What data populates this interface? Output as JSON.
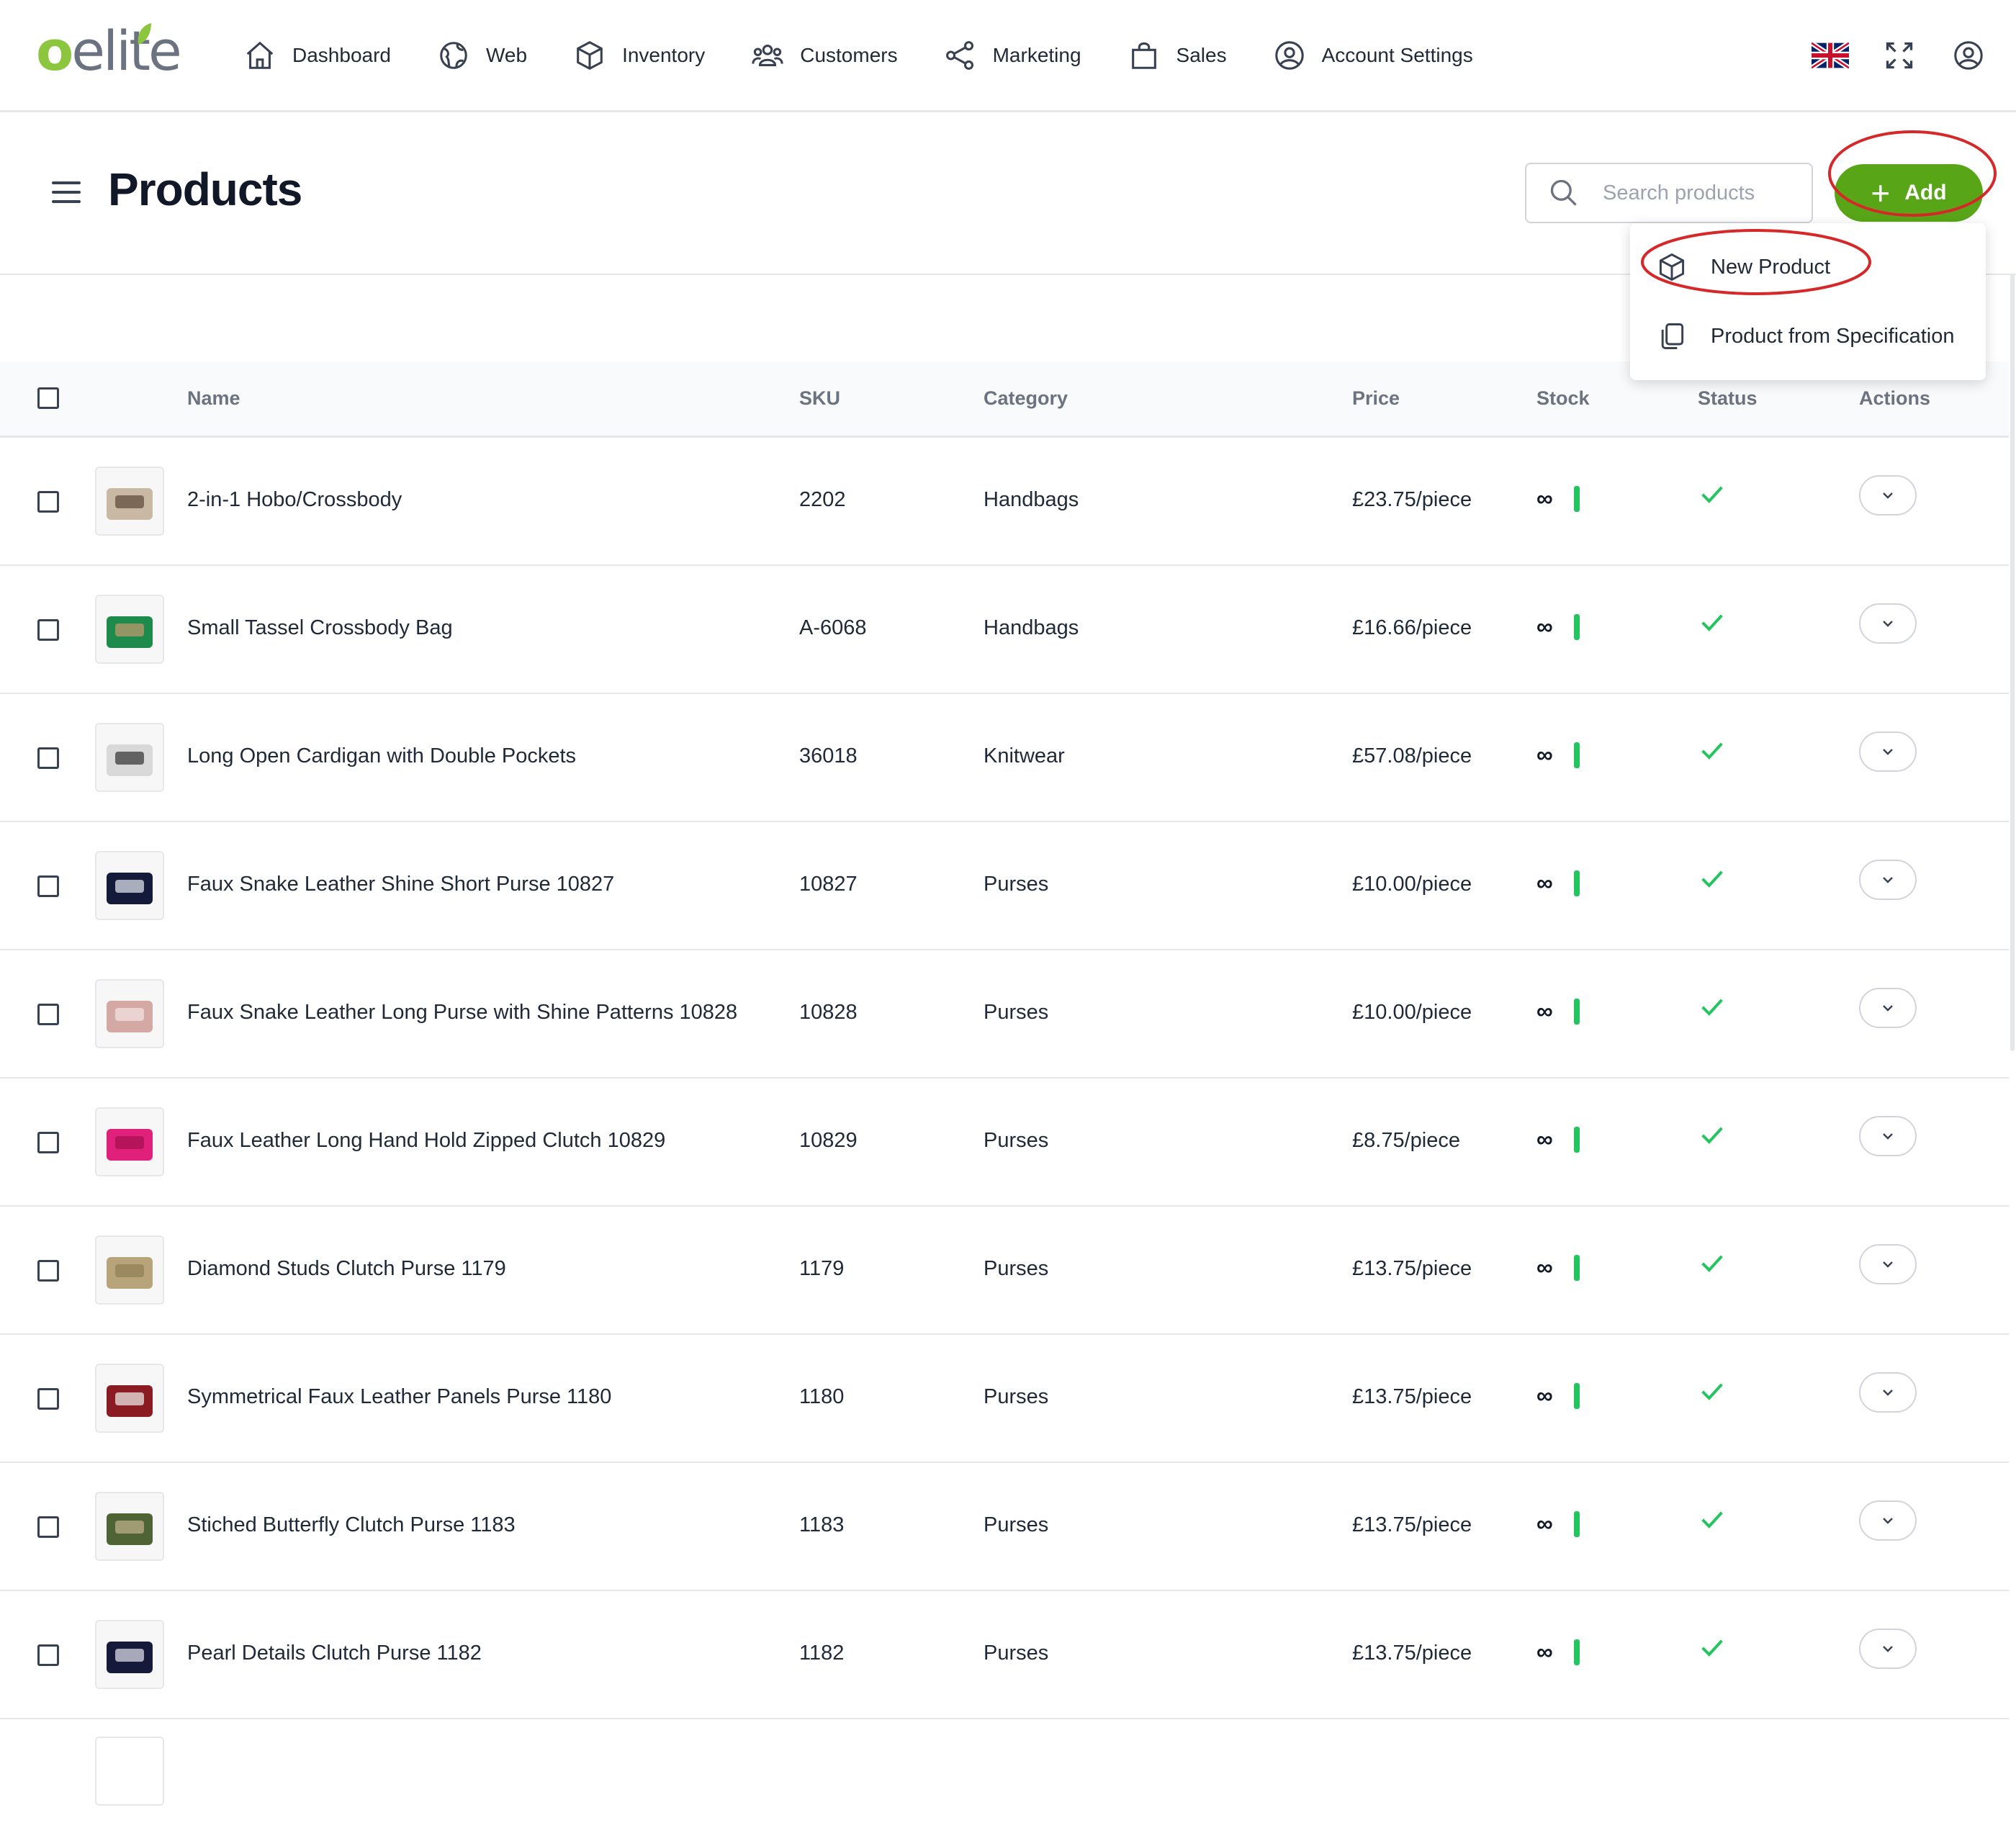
{
  "app": {
    "logo_o": "o",
    "logo_rest": "elite"
  },
  "nav": {
    "items": [
      {
        "label": "Dashboard",
        "icon": "home-icon"
      },
      {
        "label": "Web",
        "icon": "globe-icon"
      },
      {
        "label": "Inventory",
        "icon": "box-icon"
      },
      {
        "label": "Customers",
        "icon": "users-icon"
      },
      {
        "label": "Marketing",
        "icon": "share-icon"
      },
      {
        "label": "Sales",
        "icon": "shopping-bag-icon"
      },
      {
        "label": "Account Settings",
        "icon": "user-circle-icon"
      }
    ],
    "right_icons": [
      "uk-flag-icon",
      "fullscreen-icon",
      "profile-icon"
    ]
  },
  "header": {
    "title": "Products",
    "search_placeholder": "Search products",
    "add_label": "Add"
  },
  "add_menu": {
    "items": [
      {
        "label": "New Product",
        "icon": "cube-icon"
      },
      {
        "label": "Product from Specification",
        "icon": "copy-icon"
      }
    ]
  },
  "table": {
    "columns": [
      "Name",
      "SKU",
      "Category",
      "Price",
      "Stock",
      "Status",
      "Actions"
    ],
    "rows": [
      {
        "name": "2-in-1 Hobo/Crossbody",
        "sku": "2202",
        "category": "Handbags",
        "price": "£23.75/piece",
        "stock": "∞"
      },
      {
        "name": "Small Tassel Crossbody Bag",
        "sku": "A-6068",
        "category": "Handbags",
        "price": "£16.66/piece",
        "stock": "∞"
      },
      {
        "name": "Long Open Cardigan with Double Pockets",
        "sku": "36018",
        "category": "Knitwear",
        "price": "£57.08/piece",
        "stock": "∞"
      },
      {
        "name": "Faux Snake Leather Shine Short Purse 10827",
        "sku": "10827",
        "category": "Purses",
        "price": "£10.00/piece",
        "stock": "∞"
      },
      {
        "name": "Faux Snake Leather Long Purse with Shine Patterns 10828",
        "sku": "10828",
        "category": "Purses",
        "price": "£10.00/piece",
        "stock": "∞"
      },
      {
        "name": "Faux Leather Long Hand Hold Zipped Clutch 10829",
        "sku": "10829",
        "category": "Purses",
        "price": "£8.75/piece",
        "stock": "∞"
      },
      {
        "name": "Diamond Studs Clutch Purse 1179",
        "sku": "1179",
        "category": "Purses",
        "price": "£13.75/piece",
        "stock": "∞"
      },
      {
        "name": "Symmetrical Faux Leather Panels Purse 1180",
        "sku": "1180",
        "category": "Purses",
        "price": "£13.75/piece",
        "stock": "∞"
      },
      {
        "name": "Stiched Butterfly Clutch Purse 1183",
        "sku": "1183",
        "category": "Purses",
        "price": "£13.75/piece",
        "stock": "∞"
      },
      {
        "name": "Pearl Details Clutch Purse 1182",
        "sku": "1182",
        "category": "Purses",
        "price": "£13.75/piece",
        "stock": "∞"
      }
    ]
  },
  "colors": {
    "brand_green": "#58a618",
    "status_green": "#22c55e",
    "annotation_red": "#d62828"
  }
}
